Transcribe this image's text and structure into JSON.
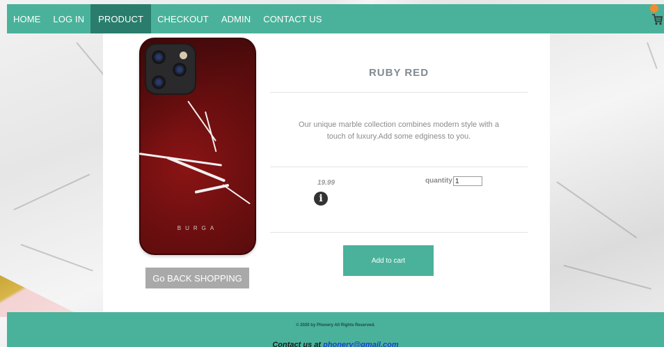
{
  "nav": {
    "items": [
      {
        "label": "HOME",
        "active": false
      },
      {
        "label": "LOG IN",
        "active": false
      },
      {
        "label": "PRODUCT",
        "active": true
      },
      {
        "label": "CHECKOUT",
        "active": false
      },
      {
        "label": "ADMIN",
        "active": false
      },
      {
        "label": "CONTACT US",
        "active": false
      }
    ],
    "cart_icon": "shopping-cart-icon"
  },
  "product": {
    "name": "RUBY RED",
    "description": "Our unique marble collection combines modern style with a touch of luxury.Add some edginess to you.",
    "price": "19.99",
    "quantity_label": "quantity",
    "quantity_value": "1",
    "image_brand_text": "BURGA",
    "info_icon": "info-icon"
  },
  "buttons": {
    "add_to_cart": "Add to cart",
    "back_shopping": "Go BACK SHOPPING"
  },
  "footer": {
    "copyright": "© 2020 by Phonery All Rights Reserved.",
    "contact_prefix": "Contact us at ",
    "contact_email": "phonery@gmail.com"
  },
  "colors": {
    "accent": "#4ab29a",
    "nav_active": "#2a7d6c",
    "cart_badge": "#f28a2e",
    "back_button": "#a9a9a9"
  }
}
